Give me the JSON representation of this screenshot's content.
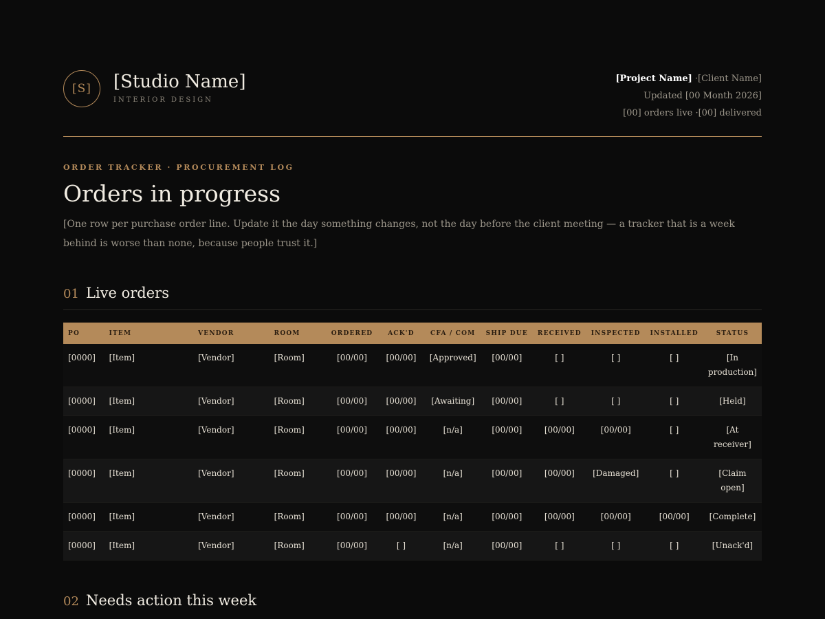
{
  "brand": {
    "monogram": "[S]",
    "name": "[Studio Name]",
    "subtitle": "INTERIOR DESIGN"
  },
  "meta": {
    "project": "[Project Name]",
    "separator": " ·",
    "client": "[Client Name]",
    "updated": "Updated [00 Month 2026]",
    "counts": "[00] orders live ·[00] delivered"
  },
  "intro": {
    "eyebrow": "ORDER TRACKER · PROCUREMENT LOG",
    "title": "Orders in progress",
    "description": "[One row per purchase order line. Update it the day something changes, not the day before the client meeting — a tracker that is a week behind is worse than none, because people trust it.]"
  },
  "sections": [
    {
      "num": "01",
      "title": "Live orders"
    },
    {
      "num": "02",
      "title": "Needs action this week"
    }
  ],
  "table": {
    "headers": [
      "PO",
      "ITEM",
      "VENDOR",
      "ROOM",
      "ORDERED",
      "ACK'D",
      "CFA / COM",
      "SHIP DUE",
      "RECEIVED",
      "INSPECTED",
      "INSTALLED",
      "STATUS"
    ],
    "rows": [
      [
        "[0000]",
        "[Item]",
        "[Vendor]",
        "[Room]",
        "[00/00]",
        "[00/00]",
        "[Approved]",
        "[00/00]",
        "[ ]",
        "[ ]",
        "[ ]",
        "[In production]"
      ],
      [
        "[0000]",
        "[Item]",
        "[Vendor]",
        "[Room]",
        "[00/00]",
        "[00/00]",
        "[Awaiting]",
        "[00/00]",
        "[ ]",
        "[ ]",
        "[ ]",
        "[Held]"
      ],
      [
        "[0000]",
        "[Item]",
        "[Vendor]",
        "[Room]",
        "[00/00]",
        "[00/00]",
        "[n/a]",
        "[00/00]",
        "[00/00]",
        "[00/00]",
        "[ ]",
        "[At receiver]"
      ],
      [
        "[0000]",
        "[Item]",
        "[Vendor]",
        "[Room]",
        "[00/00]",
        "[00/00]",
        "[n/a]",
        "[00/00]",
        "[00/00]",
        "[Damaged]",
        "[ ]",
        "[Claim open]"
      ],
      [
        "[0000]",
        "[Item]",
        "[Vendor]",
        "[Room]",
        "[00/00]",
        "[00/00]",
        "[n/a]",
        "[00/00]",
        "[00/00]",
        "[00/00]",
        "[00/00]",
        "[Complete]"
      ],
      [
        "[0000]",
        "[Item]",
        "[Vendor]",
        "[Room]",
        "[00/00]",
        "[ ]",
        "[n/a]",
        "[00/00]",
        "[ ]",
        "[ ]",
        "[ ]",
        "[Unack'd]"
      ]
    ]
  }
}
